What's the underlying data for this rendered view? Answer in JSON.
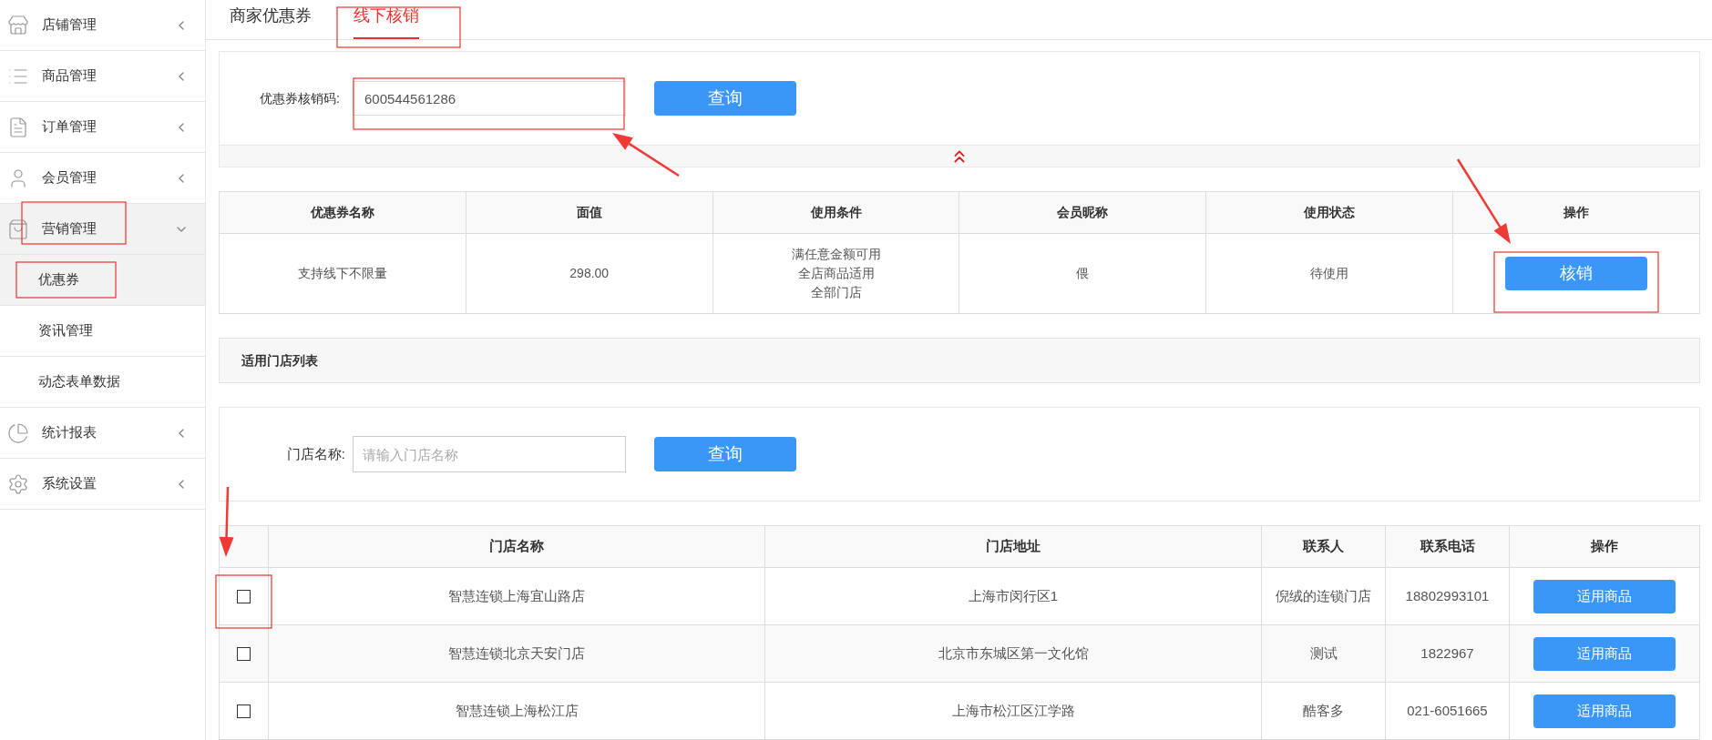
{
  "sidebar": {
    "items": [
      {
        "label": "店铺管理",
        "expanded": false,
        "selected": false
      },
      {
        "label": "商品管理",
        "expanded": false,
        "selected": false
      },
      {
        "label": "订单管理",
        "expanded": false,
        "selected": false
      },
      {
        "label": "会员管理",
        "expanded": false,
        "selected": false
      },
      {
        "label": "营销管理",
        "expanded": true,
        "selected": true,
        "children": [
          {
            "label": "优惠券",
            "selected": true
          },
          {
            "label": "资讯管理",
            "selected": false
          },
          {
            "label": "动态表单数据",
            "selected": false
          }
        ]
      },
      {
        "label": "统计报表",
        "expanded": false,
        "selected": false
      },
      {
        "label": "系统设置",
        "expanded": false,
        "selected": false
      }
    ]
  },
  "tabs": [
    {
      "label": "商家优惠券",
      "selected": false
    },
    {
      "label": "线下核销",
      "selected": true
    }
  ],
  "code_search": {
    "label": "优惠券核销码:",
    "value": "600544561286",
    "button": "查询"
  },
  "coupon_table": {
    "columns": [
      "优惠券名称",
      "面值",
      "使用条件",
      "会员昵称",
      "使用状态",
      "操作"
    ],
    "rows": [
      {
        "name": "支持线下不限量",
        "value": "298.00",
        "conditions": [
          "满任意金额可用",
          "全店商品适用",
          "全部门店"
        ],
        "member": "偎",
        "status": "待使用",
        "action": "核销"
      }
    ]
  },
  "store_section": {
    "title": "适用门店列表"
  },
  "store_search": {
    "label": "门店名称:",
    "placeholder": "请输入门店名称",
    "button": "查询"
  },
  "store_table": {
    "columns": [
      "门店名称",
      "门店地址",
      "联系人",
      "联系电话",
      "操作"
    ],
    "rows": [
      {
        "checked": false,
        "name": "智慧连锁上海宜山路店",
        "address": "上海市闵行区1",
        "contact": "倪绒的连锁门店",
        "phone": "18802993101",
        "action": "适用商品"
      },
      {
        "checked": false,
        "name": "智慧连锁北京天安门店",
        "address": "北京市东城区第一文化馆",
        "contact": "测试",
        "phone": "1822967",
        "action": "适用商品"
      },
      {
        "checked": false,
        "name": "智慧连锁上海松江店",
        "address": "上海市松江区江学路",
        "contact": "酷客多",
        "phone": "021-6051665",
        "action": "适用商品"
      }
    ]
  }
}
